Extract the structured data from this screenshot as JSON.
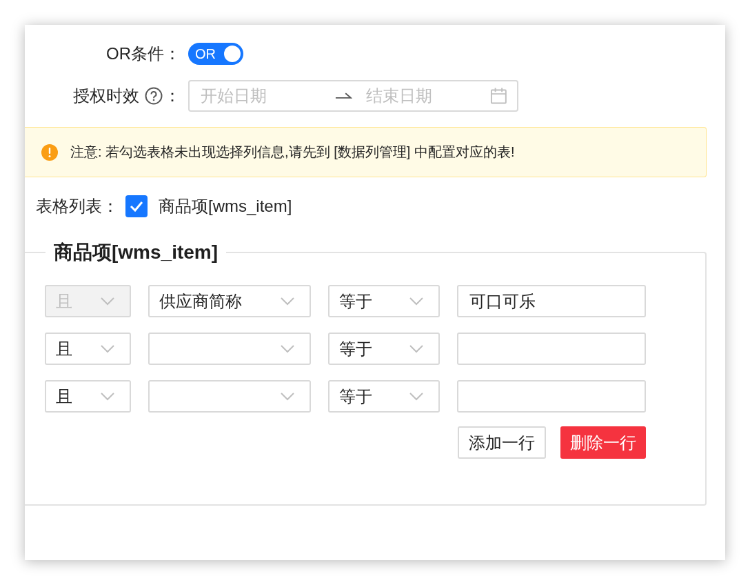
{
  "or_condition": {
    "label": "OR条件：",
    "toggle": {
      "text": "OR",
      "on": true
    }
  },
  "validity": {
    "label": "授权时效",
    "colon": "：",
    "start_placeholder": "开始日期",
    "end_placeholder": "结束日期"
  },
  "alert": {
    "text": "注意: 若勾选表格未出现选择列信息,请先到 [数据列管理] 中配置对应的表!"
  },
  "table_list": {
    "label": "表格列表：",
    "options": [
      {
        "label": "商品项[wms_item]",
        "checked": true
      }
    ]
  },
  "filter_group": {
    "title": "商品项[wms_item]",
    "rows": [
      {
        "logic": "且",
        "disabled": true,
        "field": "供应商简称",
        "operator": "等于",
        "value": "可口可乐"
      },
      {
        "logic": "且",
        "disabled": false,
        "operator": "等于"
      },
      {
        "logic": "且",
        "disabled": false,
        "operator": "等于"
      }
    ]
  },
  "buttons": [
    {
      "label": "添加一行",
      "kind": "default"
    },
    {
      "label": "删除一行",
      "kind": "danger"
    }
  ]
}
